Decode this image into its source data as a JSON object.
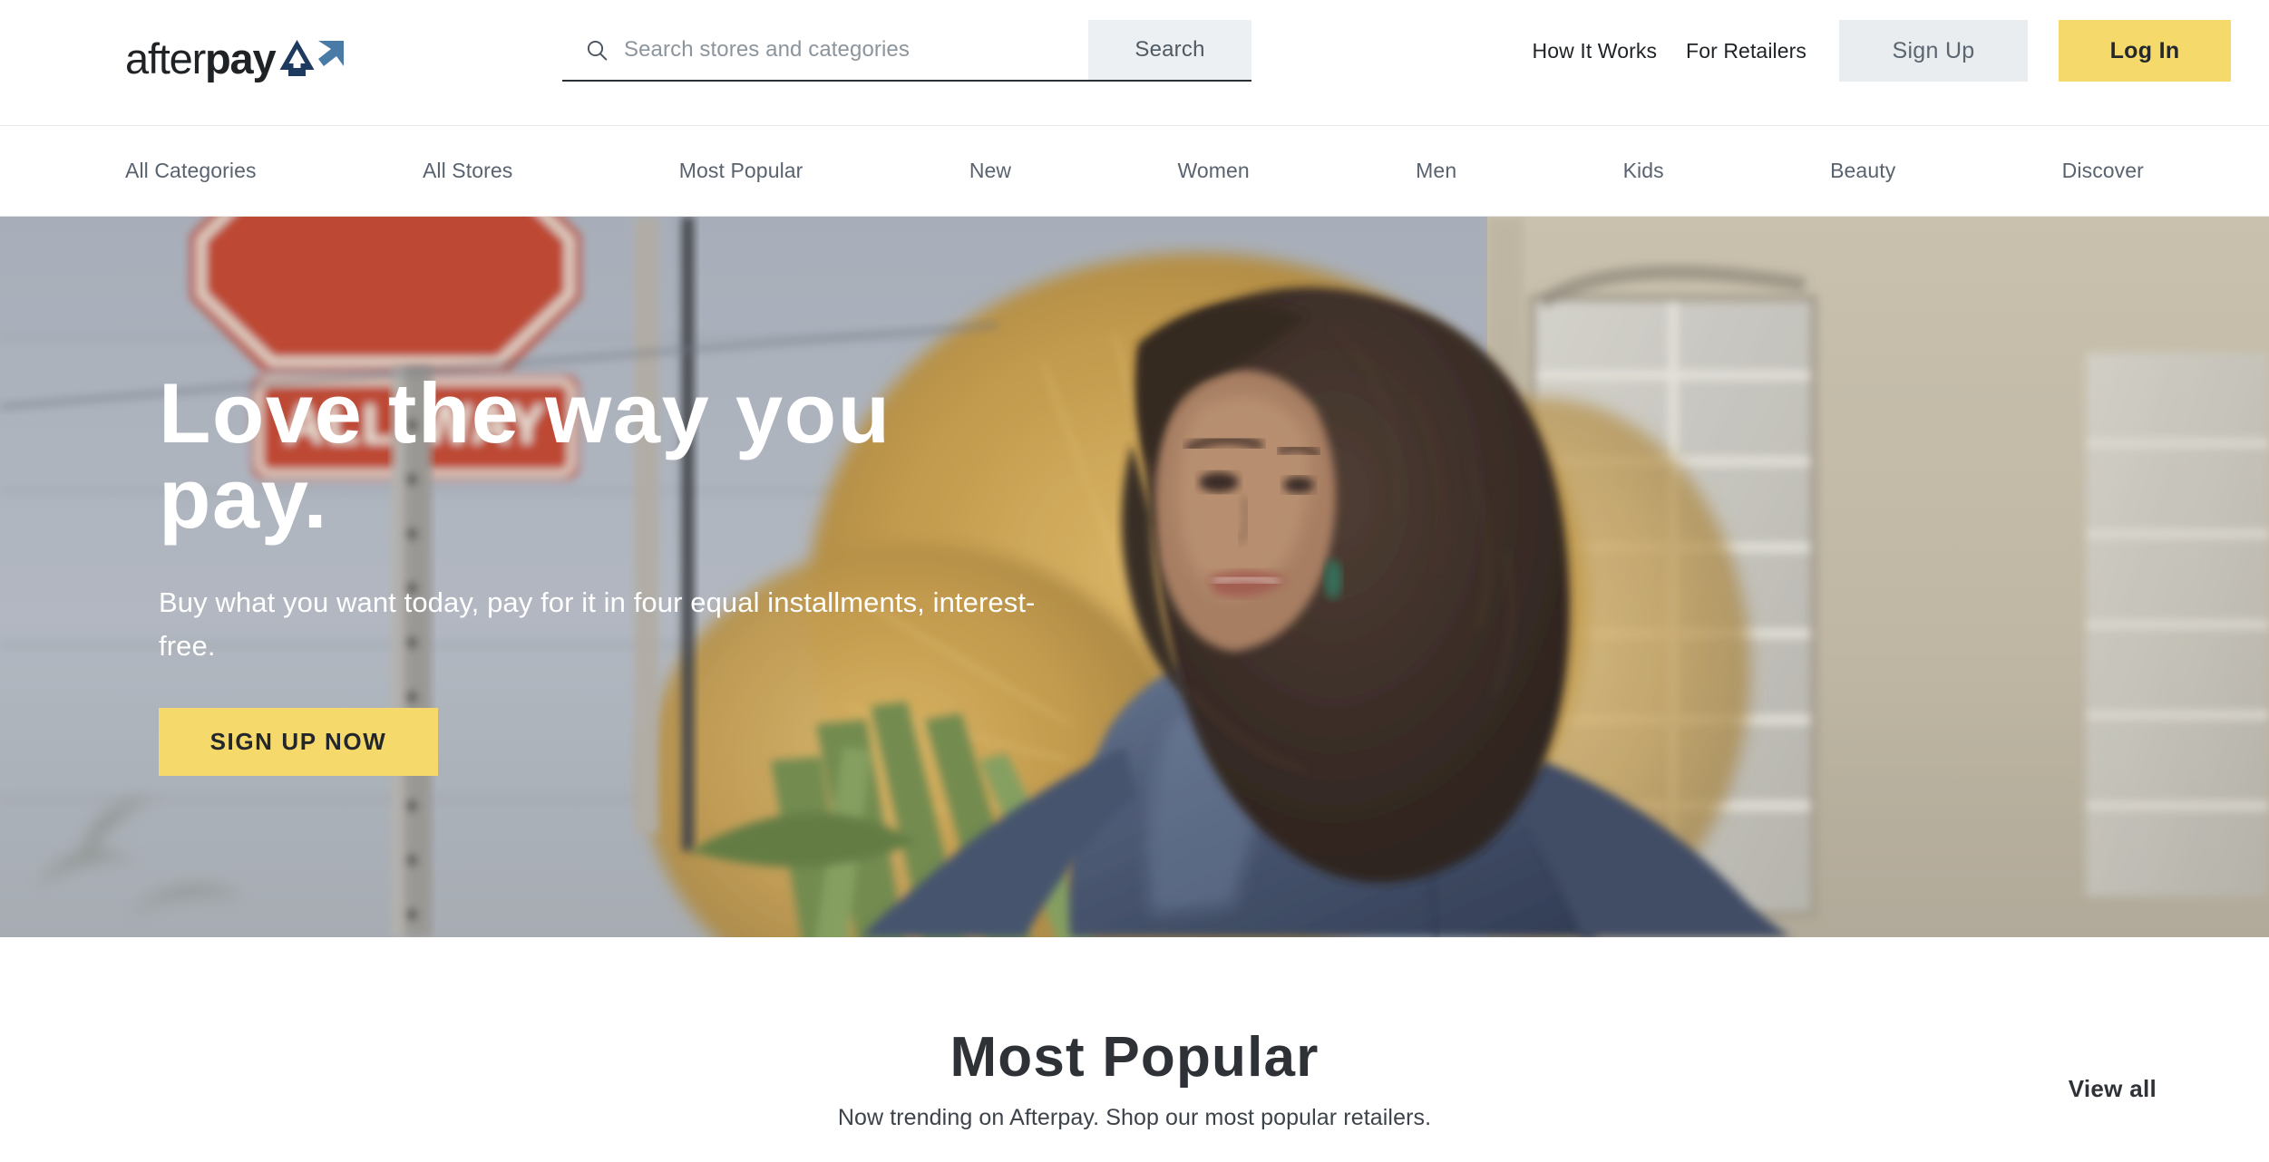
{
  "brand": {
    "name": "afterpay",
    "name_light": "after",
    "name_bold": "pay",
    "mark_color_dark": "#1e3a5f",
    "mark_color_light": "#4a7ba7",
    "accent_yellow": "#f5d96b",
    "accent_pink": "#f8ddd3"
  },
  "search": {
    "placeholder": "Search stores and categories",
    "value": "",
    "button_label": "Search",
    "icon": "search-icon"
  },
  "topnav": {
    "links": [
      {
        "label": "How It Works"
      },
      {
        "label": "For Retailers"
      }
    ],
    "signup_label": "Sign Up",
    "login_label": "Log In"
  },
  "catnav": {
    "items": [
      {
        "label": "All Categories"
      },
      {
        "label": "All Stores"
      },
      {
        "label": "Most Popular"
      },
      {
        "label": "New"
      },
      {
        "label": "Women"
      },
      {
        "label": "Men"
      },
      {
        "label": "Kids"
      },
      {
        "label": "Beauty"
      },
      {
        "label": "Discover"
      }
    ]
  },
  "hero": {
    "title": "Love the way you pay.",
    "subtitle": "Buy what you want today, pay for it in four equal installments, interest-free.",
    "cta_label": "SIGN UP NOW",
    "image_alt": "Woman with curly hair in a navy leather jacket walking past a golden bush, an ALL-WAY stop sign and a glass block window",
    "sign_text": "ALL-WAY"
  },
  "popular": {
    "title": "Most Popular",
    "subtitle": "Now trending on Afterpay. Shop our most popular retailers.",
    "view_all_label": "View all"
  }
}
